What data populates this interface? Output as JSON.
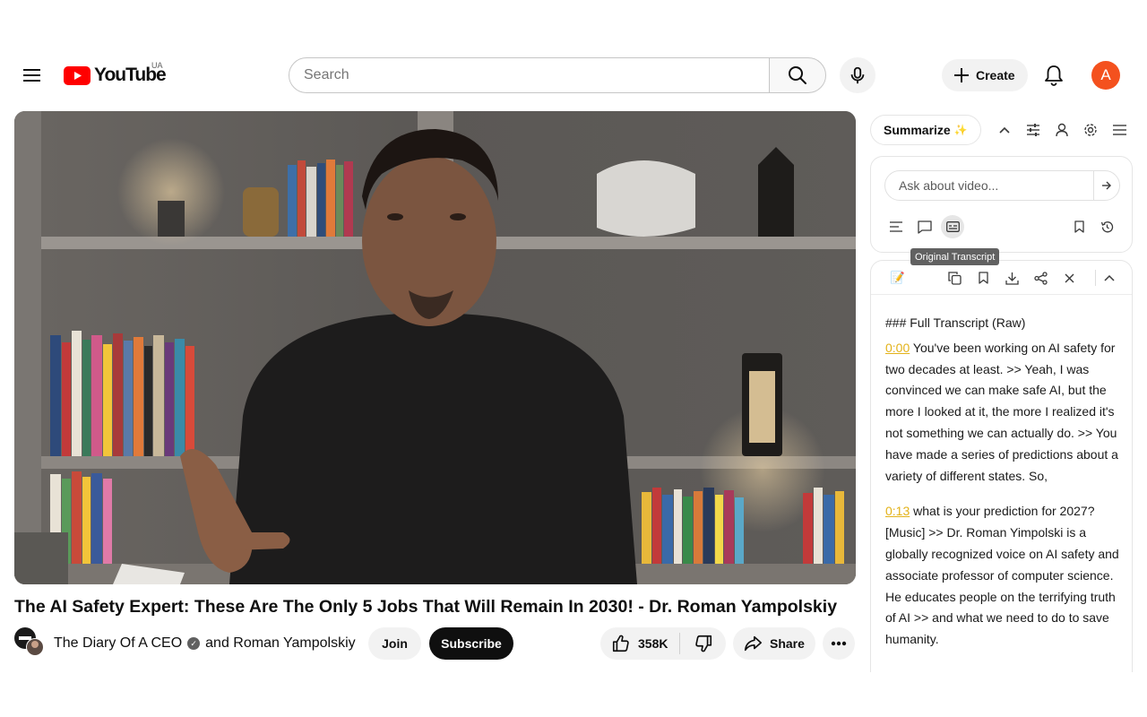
{
  "header": {
    "logo_text": "YouTube",
    "country_code": "UA",
    "search_placeholder": "Search",
    "create_label": "Create",
    "avatar_letter": "A",
    "accent_color": "#ff0000",
    "avatar_color": "#f4511e"
  },
  "video": {
    "title": "The AI Safety Expert: These Are The Only 5 Jobs That Will Remain In 2030! - Dr. Roman Yampolskiy",
    "channel": "The Diary Of A CEO",
    "collaborator_text": "and Roman Yampolskiy",
    "join_label": "Join",
    "subscribe_label": "Subscribe",
    "like_count": "358K",
    "share_label": "Share"
  },
  "panel": {
    "summarize_label": "Summarize",
    "summarize_emoji": "✨",
    "ask_placeholder": "Ask about video...",
    "tooltip": "Original Transcript",
    "note_emoji": "📝",
    "transcript_heading": "### Full Transcript (Raw)",
    "transcript": [
      {
        "time": "0:00",
        "text": "You've been working on AI safety for two decades at least. >> Yeah, I was convinced we can make safe AI, but the more I looked at it, the more I realized it's not something we can actually do. >> You have made a series of predictions about a variety of different states. So,"
      },
      {
        "time": "0:13",
        "text": "what is your prediction for 2027? [Music] >> Dr. Roman Yimpolski is a globally recognized voice on AI safety and associate professor of computer science. He educates people on the terrifying truth of AI >> and what we need to do to save humanity."
      }
    ],
    "timestamp_color": "#e3b219"
  }
}
